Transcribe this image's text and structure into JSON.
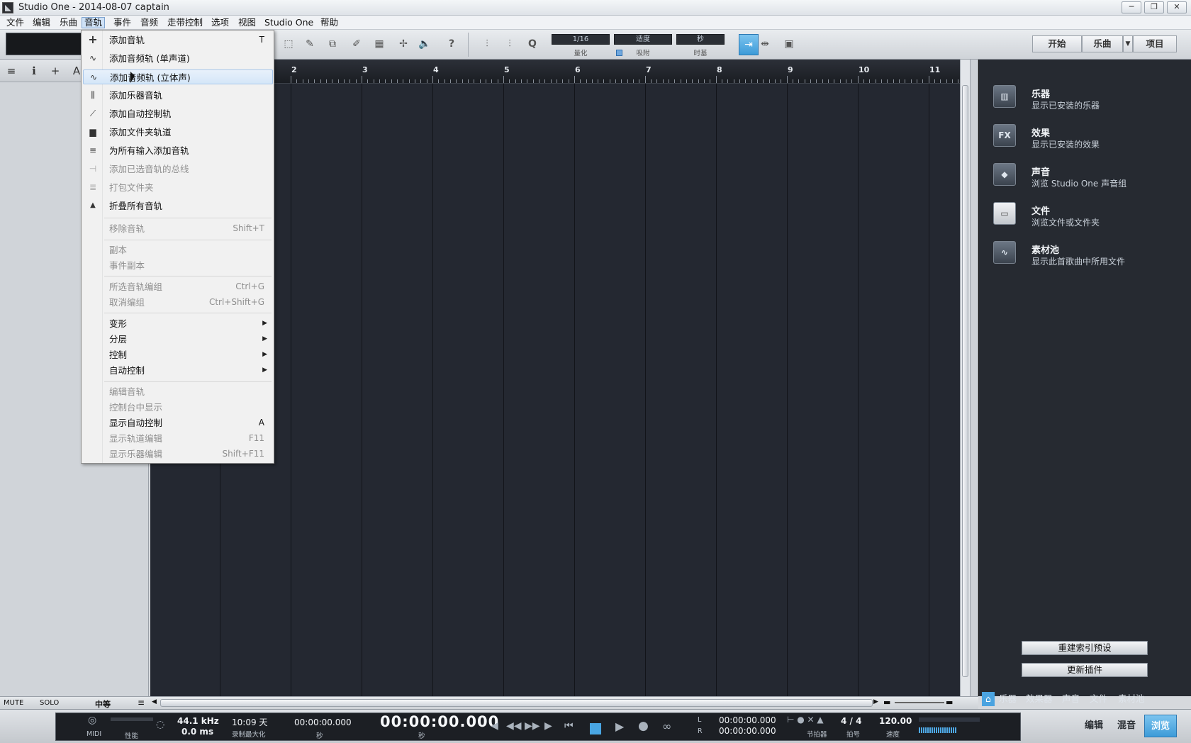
{
  "window": {
    "title": "Studio One - 2014-08-07 captain",
    "minimize": "─",
    "restore": "❐",
    "close": "✕"
  },
  "menubar": [
    {
      "label": "文件"
    },
    {
      "label": "编辑"
    },
    {
      "label": "乐曲"
    },
    {
      "label": "音轨"
    },
    {
      "label": "事件"
    },
    {
      "label": "音频"
    },
    {
      "label": "走带控制"
    },
    {
      "label": "选项"
    },
    {
      "label": "视图"
    },
    {
      "label": "Studio One"
    },
    {
      "label": "帮助"
    }
  ],
  "toolbar": {
    "quantize": {
      "value": "1/16",
      "label": "量化"
    },
    "snap": {
      "value": "适度",
      "label": "吸附"
    },
    "timebase": {
      "value": "秒",
      "label": "时基"
    },
    "help": "?",
    "quantize_q": "Q",
    "nav": {
      "start": "开始",
      "song": "乐曲",
      "project": "项目"
    }
  },
  "ruler": {
    "bars": [
      "2",
      "3",
      "4",
      "5",
      "6",
      "7",
      "8",
      "9",
      "10",
      "11"
    ]
  },
  "track_panel": {
    "mute": "MUTE",
    "solo": "SOLO",
    "size": "中等"
  },
  "track_menu": {
    "items": [
      {
        "label": "添加音轨",
        "shortcut": "T",
        "icon": "plus-icon",
        "glyph": "+",
        "disabled": false
      },
      {
        "label": "添加音频轨 (单声道)",
        "shortcut": "",
        "icon": "waveform-mono-icon",
        "glyph": "∿",
        "disabled": false
      },
      {
        "label": "添加音频轨 (立体声)",
        "shortcut": "",
        "icon": "waveform-stereo-icon",
        "glyph": "∿",
        "disabled": false
      },
      {
        "label": "添加乐器音轨",
        "shortcut": "",
        "icon": "instrument-icon",
        "glyph": "⫼",
        "disabled": false
      },
      {
        "label": "添加自动控制轨",
        "shortcut": "",
        "icon": "automation-icon",
        "glyph": "⟋",
        "disabled": false
      },
      {
        "label": "添加文件夹轨道",
        "shortcut": "",
        "icon": "folder-icon",
        "glyph": "▆",
        "disabled": false
      },
      {
        "label": "为所有输入添加音轨",
        "shortcut": "",
        "icon": "add-tracks-icon",
        "glyph": "≡",
        "disabled": false
      },
      {
        "label": "添加已选音轨的总线",
        "shortcut": "",
        "icon": "bus-icon",
        "glyph": "⊣",
        "disabled": true
      },
      {
        "label": "打包文件夹",
        "shortcut": "",
        "icon": "pack-folder-icon",
        "glyph": "≣",
        "disabled": true
      },
      {
        "label": "折叠所有音轨",
        "shortcut": "",
        "icon": "collapse-icon",
        "glyph": "▲",
        "disabled": false
      },
      {
        "label": "移除音轨",
        "shortcut": "Shift+T",
        "disabled": true
      },
      {
        "label": "副本",
        "shortcut": "",
        "disabled": true
      },
      {
        "label": "事件副本",
        "shortcut": "",
        "disabled": true
      },
      {
        "label": "所选音轨编组",
        "shortcut": "Ctrl+G",
        "disabled": true
      },
      {
        "label": "取消编组",
        "shortcut": "Ctrl+Shift+G",
        "disabled": true
      },
      {
        "label": "变形",
        "submenu": true,
        "disabled": false
      },
      {
        "label": "分层",
        "submenu": true,
        "disabled": false
      },
      {
        "label": "控制",
        "submenu": true,
        "disabled": false
      },
      {
        "label": "自动控制",
        "submenu": true,
        "disabled": false
      },
      {
        "label": "编辑音轨",
        "shortcut": "",
        "disabled": true
      },
      {
        "label": "控制台中显示",
        "shortcut": "",
        "disabled": true
      },
      {
        "label": "显示自动控制",
        "shortcut": "A",
        "disabled": false
      },
      {
        "label": "显示轨道编辑",
        "shortcut": "F11",
        "disabled": true
      },
      {
        "label": "显示乐器编辑",
        "shortcut": "Shift+F11",
        "disabled": true
      }
    ],
    "submenu_arrow": "▶"
  },
  "browser": {
    "items": [
      {
        "title": "乐器",
        "subtitle": "显示已安装的乐器",
        "icon": "piano-icon",
        "glyph": "▥"
      },
      {
        "title": "效果",
        "subtitle": "显示已安装的效果",
        "icon": "fx-icon",
        "glyph": "FX"
      },
      {
        "title": "声音",
        "subtitle": "浏览 Studio One 声音组",
        "icon": "sound-cube-icon",
        "glyph": "◆"
      },
      {
        "title": "文件",
        "subtitle": "浏览文件或文件夹",
        "icon": "folder-icon",
        "glyph": "▭"
      },
      {
        "title": "素材池",
        "subtitle": "显示此首歌曲中所用文件",
        "icon": "pool-icon",
        "glyph": "∿"
      }
    ],
    "reindex": "重建索引预设",
    "update_plugins": "更新插件",
    "tabs": [
      "乐器",
      "效果器",
      "声音",
      "文件",
      "素材池"
    ]
  },
  "transport": {
    "midi": "MIDI",
    "performance": "性能",
    "sample_rate": "44.1 kHz",
    "latency": "0.0 ms",
    "record_max": "10:09 天",
    "record_max_label": "录制最大化",
    "secondary_time": "00:00:00.000",
    "secondary_label": "秒",
    "main_time": "00:00:00.000",
    "main_label": "秒",
    "loop_l": "00:00:00.000",
    "loop_r": "00:00:00.000",
    "l": "L",
    "r": "R",
    "metronome": "节拍器",
    "signature": "4 / 4",
    "signature_label": "拍号",
    "tempo": "120.00",
    "tempo_label": "速度",
    "views": {
      "edit": "编辑",
      "mix": "混音",
      "browse": "浏览"
    }
  }
}
